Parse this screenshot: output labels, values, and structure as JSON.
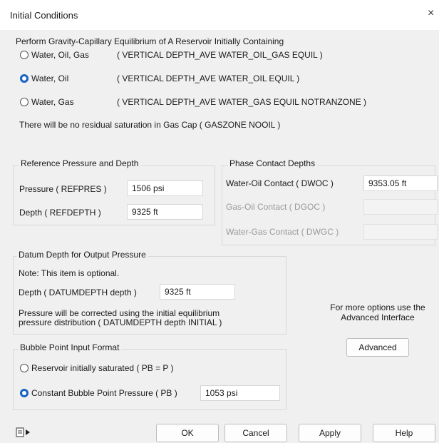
{
  "window": {
    "title": "Initial Conditions",
    "close_glyph": "×"
  },
  "equilibrium": {
    "title": "Perform Gravity-Capillary Equilibrium of A Reservoir Initially Containing",
    "options": [
      {
        "label": "Water, Oil, Gas",
        "keyword": "( VERTICAL DEPTH_AVE WATER_OIL_GAS EQUIL )",
        "selected": false
      },
      {
        "label": "Water, Oil",
        "keyword": "( VERTICAL DEPTH_AVE WATER_OIL EQUIL )",
        "selected": true
      },
      {
        "label": "Water, Gas",
        "keyword": "( VERTICAL DEPTH_AVE WATER_GAS EQUIL NOTRANZONE )",
        "selected": false
      }
    ],
    "note": "There will be no residual saturation in Gas Cap ( GASZONE NOOIL )"
  },
  "reference": {
    "title": "Reference Pressure and Depth",
    "pressure_label": "Pressure ( REFPRES )",
    "pressure_value": "1506 psi",
    "depth_label": "Depth ( REFDEPTH )",
    "depth_value": "9325 ft"
  },
  "contacts": {
    "title": "Phase Contact Depths",
    "dwoc_label": "Water-Oil Contact ( DWOC )",
    "dwoc_value": "9353.05 ft",
    "dgoc_label": "Gas-Oil Contact ( DGOC )",
    "dwgc_label": "Water-Gas Contact ( DWGC )"
  },
  "datum": {
    "title": "Datum Depth for Output Pressure",
    "note": "Note: This item is optional.",
    "depth_label": "Depth ( DATUMDEPTH depth )",
    "depth_value": "9325 ft",
    "info_line1": "Pressure will be corrected using the initial equilibrium",
    "info_line2": "pressure distribution ( DATUMDEPTH depth INITIAL )"
  },
  "advanced": {
    "hint_line1": "For more options use the",
    "hint_line2": "Advanced Interface",
    "button": "Advanced"
  },
  "bubble": {
    "title": "Bubble Point Input Format",
    "option1": "Reservoir initially saturated ( PB = P )",
    "option2": "Constant Bubble Point Pressure ( PB )",
    "option2_selected": true,
    "pb_value": "1053 psi"
  },
  "footer": {
    "ok": "OK",
    "cancel": "Cancel",
    "apply": "Apply",
    "help": "Help"
  },
  "colors": {
    "accent": "#1463c3",
    "dialog_bg": "#f0f0f0"
  }
}
